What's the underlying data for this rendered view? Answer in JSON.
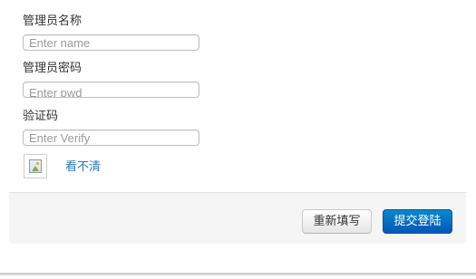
{
  "form": {
    "name_label": "管理员名称",
    "name_placeholder": "Enter name",
    "name_value": "",
    "password_label": "管理员密码",
    "password_placeholder": "Enter pwd",
    "password_value": "",
    "verify_label": "验证码",
    "verify_placeholder": "Enter Verify",
    "verify_value": "",
    "captcha_icon": "broken-image-icon",
    "refresh_captcha_label": "看不清"
  },
  "footer": {
    "reset_label": "重新填写",
    "submit_label": "提交登陆"
  },
  "colors": {
    "link": "#2a7ab0",
    "submit_button": "#0a6fc2",
    "footer_background": "#f5f5f5"
  }
}
